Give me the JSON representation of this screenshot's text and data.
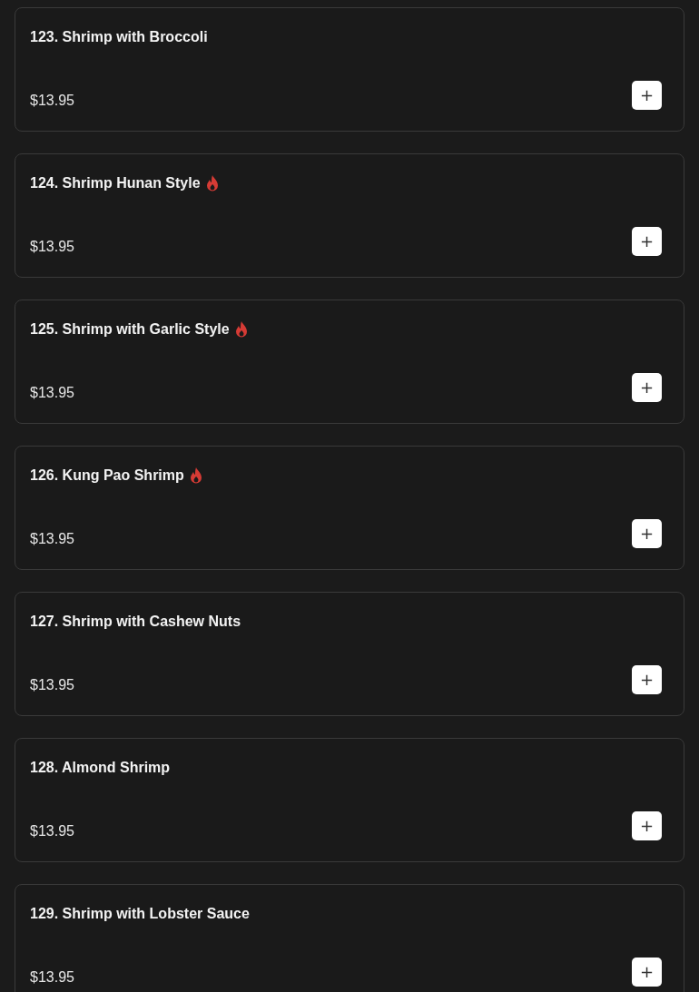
{
  "menu_items": [
    {
      "name": "123. Shrimp with Broccoli",
      "spicy": false,
      "price": "$13.95",
      "add_label": "+"
    },
    {
      "name": "124. Shrimp Hunan Style",
      "spicy": true,
      "price": "$13.95",
      "add_label": "+"
    },
    {
      "name": "125. Shrimp with Garlic Style",
      "spicy": true,
      "price": "$13.95",
      "add_label": "+"
    },
    {
      "name": "126. Kung Pao Shrimp",
      "spicy": true,
      "price": "$13.95",
      "add_label": "+"
    },
    {
      "name": "127. Shrimp with Cashew Nuts",
      "spicy": false,
      "price": "$13.95",
      "add_label": "+"
    },
    {
      "name": "128. Almond Shrimp",
      "spicy": false,
      "price": "$13.95",
      "add_label": "+"
    },
    {
      "name": "129. Shrimp with Lobster Sauce",
      "spicy": false,
      "price": "$13.95",
      "add_label": "+"
    }
  ]
}
